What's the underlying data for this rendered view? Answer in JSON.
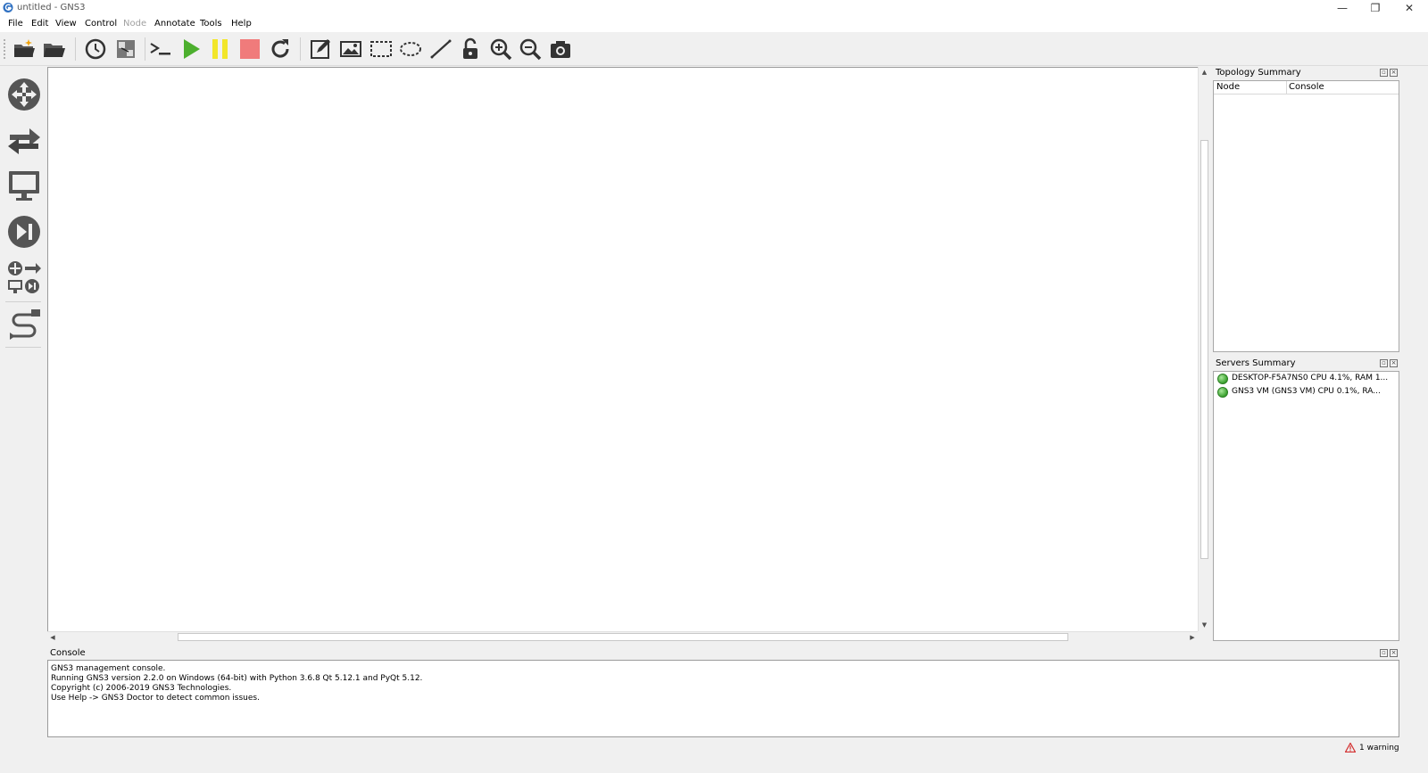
{
  "window": {
    "title": "untitled - GNS3",
    "minimize": "—",
    "maximize": "❐",
    "close": "✕"
  },
  "menu": {
    "file": "File",
    "edit": "Edit",
    "view": "View",
    "control": "Control",
    "node": "Node",
    "annotate": "Annotate",
    "tools": "Tools",
    "help": "Help"
  },
  "toolbar_icons": [
    "new-project-icon",
    "open-project-icon",
    "snapshot-icon",
    "show-interface-labels-icon",
    "console-all-icon",
    "start-all-icon",
    "suspend-all-icon",
    "stop-all-icon",
    "reload-all-icon",
    "add-note-icon",
    "insert-picture-icon",
    "draw-rectangle-icon",
    "draw-ellipse-icon",
    "draw-line-icon",
    "lock-items-icon",
    "zoom-in-icon",
    "zoom-out-icon",
    "screenshot-icon"
  ],
  "colors": {
    "start": "#4caf2e",
    "suspend": "#f2e62a",
    "stop": "#f07b7b",
    "status_ok": "#3aa12e",
    "warning": "#d32f2f"
  },
  "topology": {
    "title": "Topology Summary",
    "columns": [
      "Node",
      "Console"
    ]
  },
  "servers": {
    "title": "Servers Summary",
    "items": [
      "DESKTOP-F5A7NS0 CPU 4.1%, RAM 1...",
      "GNS3 VM (GNS3 VM) CPU 0.1%, RA..."
    ]
  },
  "console": {
    "title": "Console",
    "lines": [
      "GNS3 management console.",
      "Running GNS3 version 2.2.0 on Windows (64-bit) with Python 3.6.8 Qt 5.12.1 and PyQt 5.12.",
      "Copyright (c) 2006-2019 GNS3 Technologies.",
      "Use Help -> GNS3 Doctor to detect common issues."
    ]
  },
  "status": {
    "warnings": "1 warning"
  }
}
